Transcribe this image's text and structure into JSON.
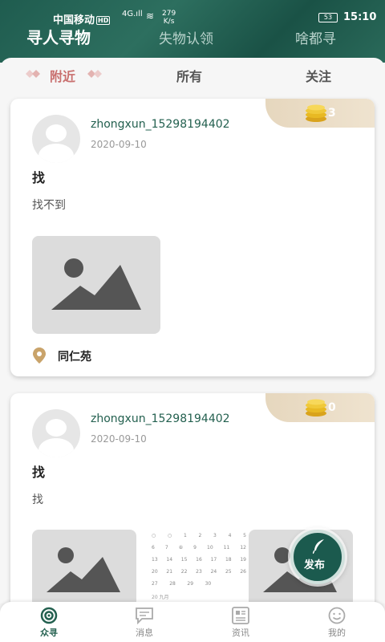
{
  "status_bar": {
    "carrier": "中国移动",
    "hd": "HD",
    "network_type": "4G",
    "speed_value": "279",
    "speed_unit": "K/s",
    "battery": "53",
    "time": "15:10"
  },
  "top_tabs": [
    {
      "label": "寻人寻物",
      "active": true
    },
    {
      "label": "失物认领",
      "active": false
    },
    {
      "label": "啥都寻",
      "active": false
    }
  ],
  "sub_tabs": [
    {
      "label": "附近",
      "active": true
    },
    {
      "label": "所有",
      "active": false
    },
    {
      "label": "关注",
      "active": false
    }
  ],
  "posts": [
    {
      "username": "zhongxun_15298194402",
      "date": "2020-09-10",
      "title": "找",
      "body": "找不到",
      "reward": "3",
      "location": "同仁苑"
    },
    {
      "username": "zhongxun_15298194402",
      "date": "2020-09-10",
      "title": "找",
      "body": "找",
      "reward": "0",
      "calendar_footer": "20 九月"
    }
  ],
  "fab": {
    "label": "发布"
  },
  "bottom_nav": [
    {
      "label": "众寻",
      "icon": "home-swirl-icon",
      "active": true
    },
    {
      "label": "消息",
      "icon": "message-icon",
      "active": false
    },
    {
      "label": "资讯",
      "icon": "news-icon",
      "active": false
    },
    {
      "label": "我的",
      "icon": "smiley-icon",
      "active": false
    }
  ],
  "colors": {
    "brand_green": "#1f5c4f",
    "accent_red": "#c9706f",
    "reward_bg": "#e6d7be",
    "coin_gold": "#e8b923"
  }
}
